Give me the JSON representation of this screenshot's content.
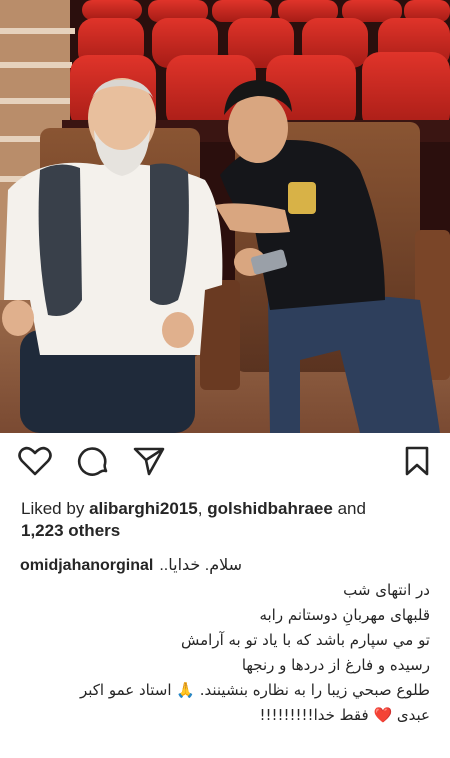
{
  "post": {
    "icons": {
      "like": "heart-outline-icon",
      "comment": "comment-bubble-icon",
      "share": "paper-plane-icon",
      "save": "bookmark-icon"
    },
    "likes": {
      "prefix": "Liked by",
      "user1": "alibarghi2015",
      "sep": ",",
      "user2": "golshidbahraee",
      "and": "and",
      "others": "1,223 others"
    },
    "caption": {
      "username": "omidjahanorginal",
      "line1": "..سلام. خدايا",
      "line2": "در انتهای شب",
      "line3": "قلبهای مهربانِ دوستانم رابه",
      "line4": "تو مي سپارم باشد که با ياد تو به آرامش",
      "line5": "رسيده و فارغ از دردها و رنجها",
      "line6": "طلوع صبحي زيبا را به نظاره بنشينند.",
      "pray_emoji": "🙏",
      "line6b": "استاد عمو اکبر",
      "line7a": "عبدی",
      "heart_emoji": "❤️",
      "line7b": "فقط خدا!!!!!!!!!"
    },
    "colors": {
      "text": "#262626",
      "seat_red": "#c8251e",
      "seat_back": "#6a3a22"
    }
  }
}
